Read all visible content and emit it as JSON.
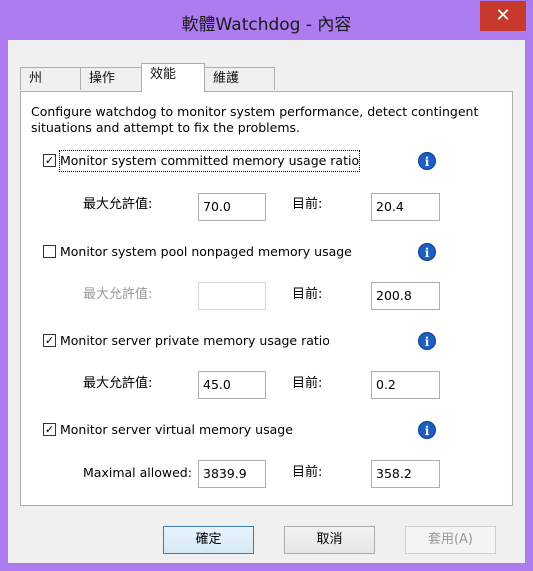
{
  "window": {
    "title": "軟體Watchdog - 內容",
    "close_glyph": "✕"
  },
  "tabs": [
    {
      "label": "州",
      "active": false
    },
    {
      "label": "操作",
      "active": false
    },
    {
      "label": "效能",
      "active": true
    },
    {
      "label": "維護",
      "active": false
    }
  ],
  "description": "Configure watchdog to monitor system performance, detect contingent situations and attempt to fix the problems.",
  "monitors": [
    {
      "label": "Monitor system committed memory usage ratio",
      "checked": true,
      "max_label": "最大允許值:",
      "max_value": "70.0",
      "current_label": "目前:",
      "current_value": "20.4",
      "enabled": true
    },
    {
      "label": "Monitor system pool nonpaged memory usage",
      "checked": false,
      "max_label": "最大允許值:",
      "max_value": "",
      "current_label": "目前:",
      "current_value": "200.8",
      "enabled": false
    },
    {
      "label": "Monitor server private memory usage ratio",
      "checked": true,
      "max_label": "最大允許值:",
      "max_value": "45.0",
      "current_label": "目前:",
      "current_value": "0.2",
      "enabled": true
    },
    {
      "label": "Monitor server virtual memory usage",
      "checked": true,
      "max_label": "Maximal allowed:",
      "max_value": "3839.9",
      "current_label": "目前:",
      "current_value": "358.2",
      "enabled": true
    }
  ],
  "info_glyph": "i",
  "check_glyph": "✓",
  "buttons": {
    "ok": "確定",
    "cancel": "取消",
    "apply": "套用(A)"
  },
  "colors": {
    "titlebar": "#ac7cf0",
    "close": "#c7392d",
    "info": "#1a5fc1"
  }
}
